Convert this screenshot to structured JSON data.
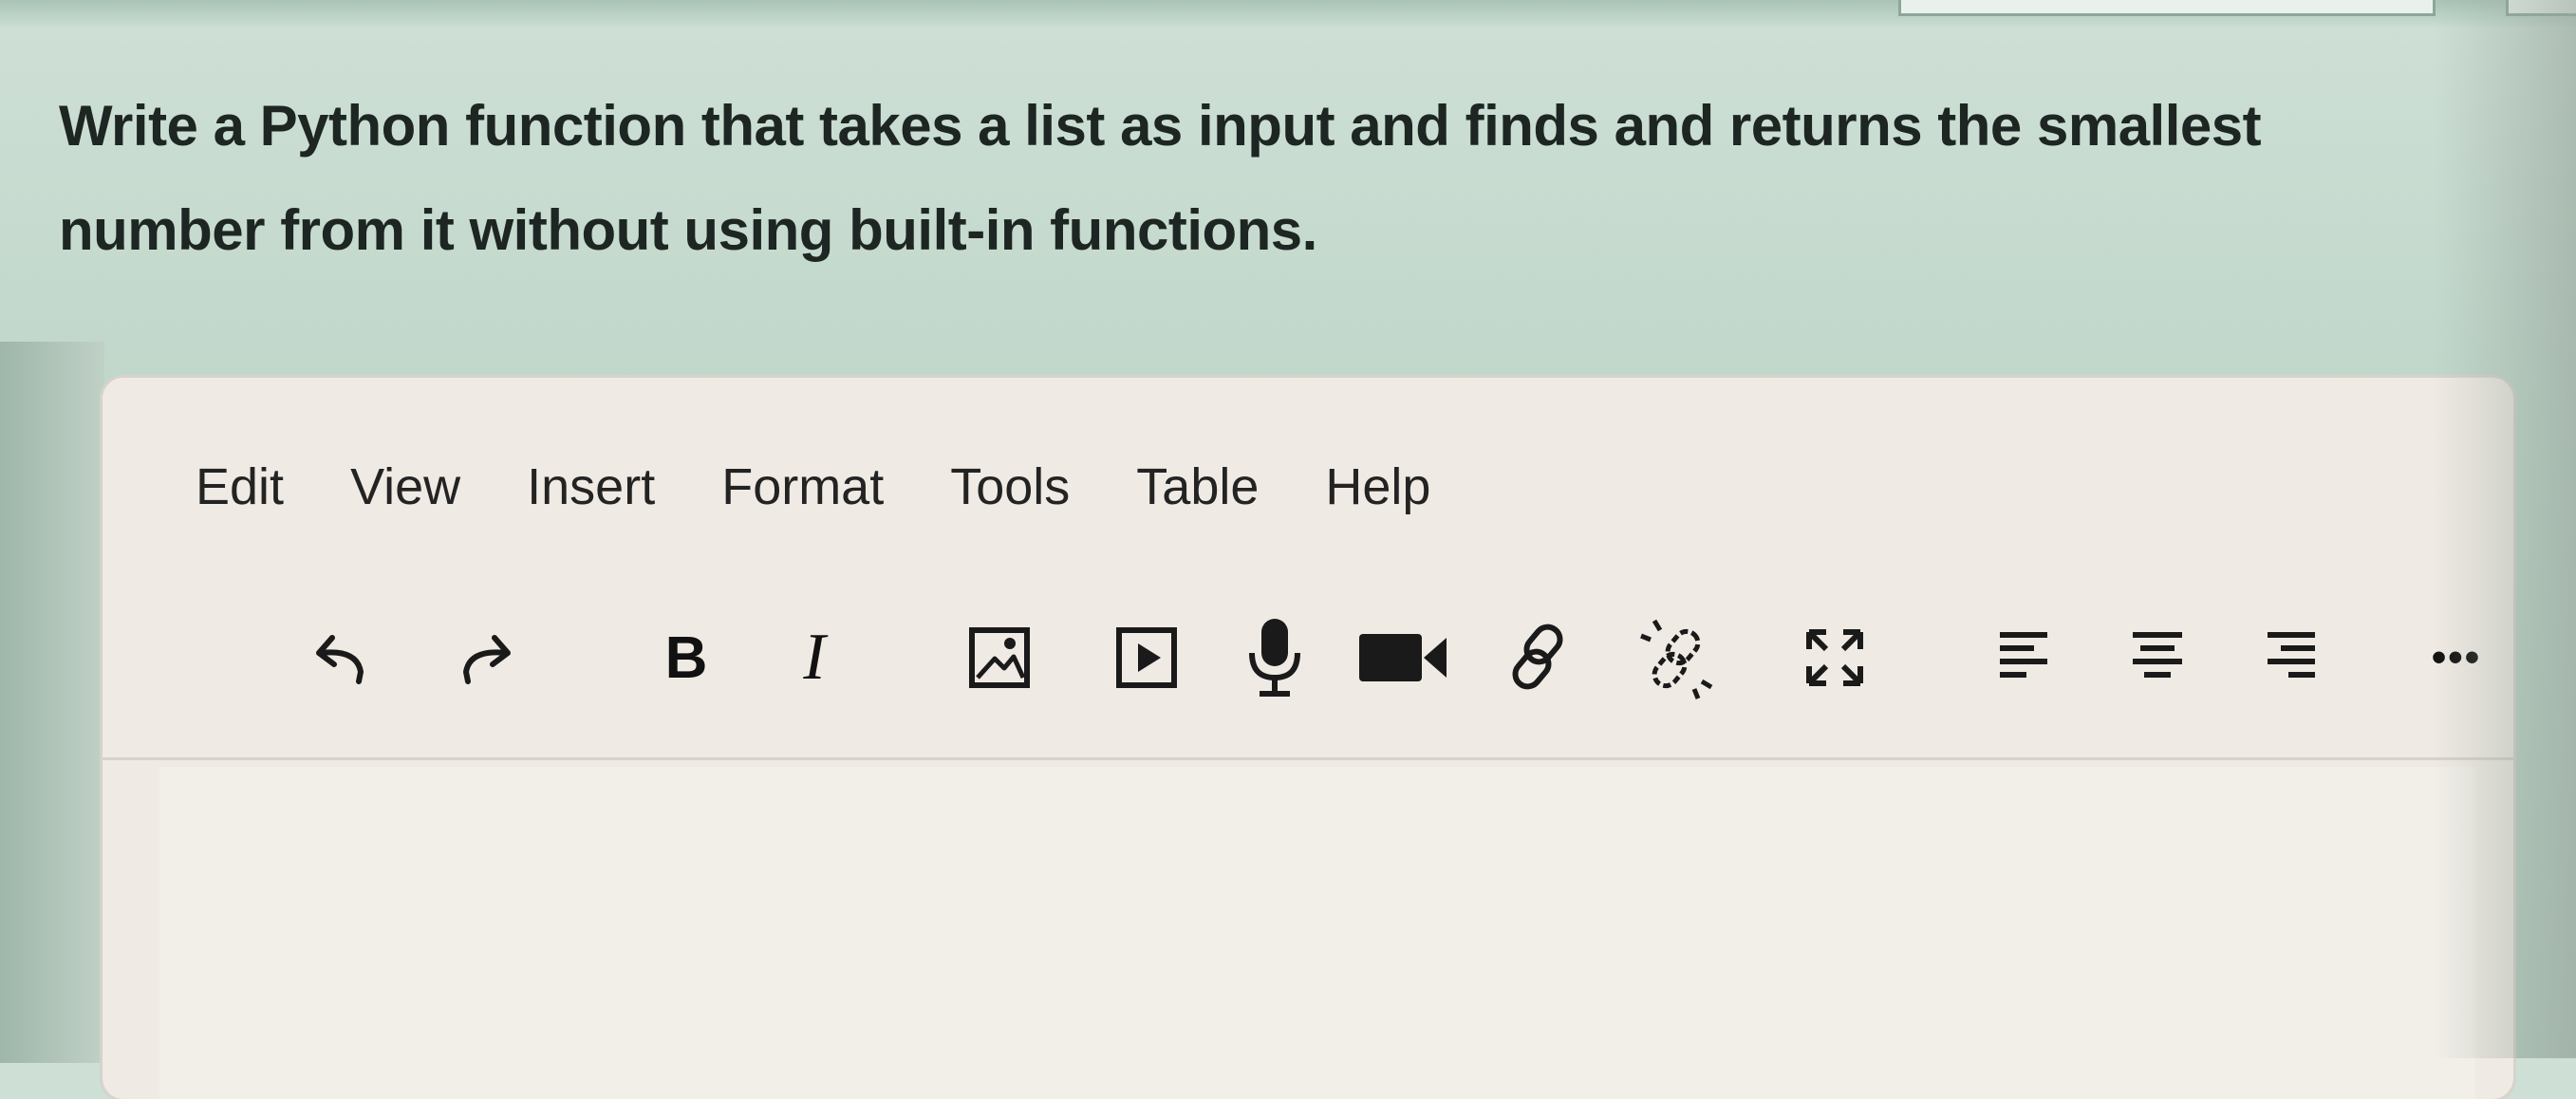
{
  "question": {
    "line1": "Write a Python function that takes a list as input and finds and returns the smallest",
    "line2": "number from it without using built-in functions."
  },
  "menubar": {
    "items": [
      "Edit",
      "View",
      "Insert",
      "Format",
      "Tools",
      "Table",
      "Help"
    ]
  },
  "toolbar": {
    "bold_label": "B",
    "italic_label": "I",
    "more_label": "•••",
    "icons": [
      "undo-icon",
      "redo-icon",
      "bold-icon",
      "italic-icon",
      "image-icon",
      "media-icon",
      "microphone-icon",
      "video-camera-icon",
      "link-icon",
      "unlink-icon",
      "fullscreen-icon",
      "align-left-icon",
      "align-center-icon",
      "align-right-icon",
      "more-icon"
    ]
  },
  "colors": {
    "page_background": "#c4d9cc",
    "editor_background": "#efeae3",
    "text": "#1d2622"
  }
}
